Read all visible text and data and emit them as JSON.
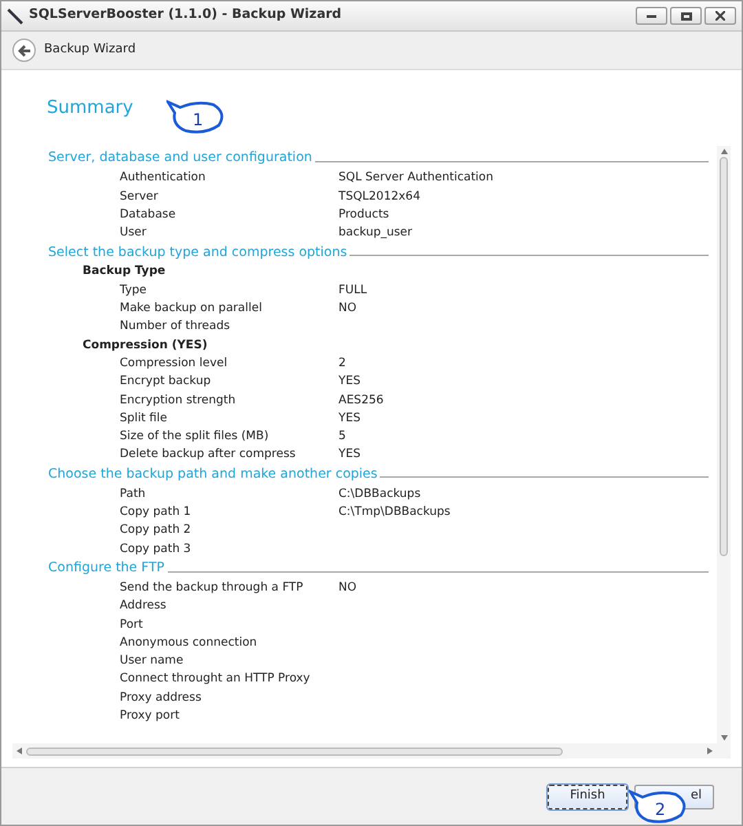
{
  "window": {
    "title": "SQLServerBooster (1.1.0) - Backup Wizard"
  },
  "header": {
    "title": "Backup Wizard"
  },
  "page_title": "Summary",
  "sections": [
    {
      "title": "Server, database and user configuration",
      "items": [
        {
          "kind": "row",
          "label": "Authentication",
          "value": "SQL Server Authentication"
        },
        {
          "kind": "row",
          "label": "Server",
          "value": "TSQL2012x64"
        },
        {
          "kind": "row",
          "label": "Database",
          "value": "Products"
        },
        {
          "kind": "row",
          "label": "User",
          "value": "backup_user"
        }
      ]
    },
    {
      "title": "Select the backup type and compress options",
      "items": [
        {
          "kind": "group",
          "label": "Backup Type"
        },
        {
          "kind": "row",
          "label": "Type",
          "value": "FULL"
        },
        {
          "kind": "row",
          "label": "Make backup on parallel",
          "value": "NO"
        },
        {
          "kind": "row",
          "label": "Number of threads"
        },
        {
          "kind": "group",
          "label": "Compression (YES)"
        },
        {
          "kind": "row",
          "label": "Compression level",
          "value": "2"
        },
        {
          "kind": "row",
          "label": "Encrypt backup",
          "value": "YES"
        },
        {
          "kind": "row",
          "label": "Encryption strength",
          "value": "AES256"
        },
        {
          "kind": "row",
          "label": "Split file",
          "value": "YES"
        },
        {
          "kind": "row",
          "label": "Size of the split files (MB)",
          "value": "5"
        },
        {
          "kind": "row",
          "label": "Delete backup after compress",
          "value": "YES"
        }
      ]
    },
    {
      "title": "Choose the backup path and make another copies",
      "items": [
        {
          "kind": "row",
          "label": "Path",
          "value": "C:\\DBBackups"
        },
        {
          "kind": "row",
          "label": "Copy path 1",
          "value": "C:\\Tmp\\DBBackups"
        },
        {
          "kind": "row",
          "label": "Copy path 2"
        },
        {
          "kind": "row",
          "label": "Copy path 3"
        }
      ]
    },
    {
      "title": "Configure the FTP",
      "items": [
        {
          "kind": "row",
          "label": "Send the backup through a FTP",
          "value": "NO"
        },
        {
          "kind": "row",
          "label": "Address"
        },
        {
          "kind": "row",
          "label": "Port"
        },
        {
          "kind": "row",
          "label": "Anonymous connection"
        },
        {
          "kind": "row",
          "label": "User name"
        },
        {
          "kind": "row",
          "label": "Connect throught an HTTP Proxy"
        },
        {
          "kind": "row",
          "label": "Proxy address"
        },
        {
          "kind": "row",
          "label": "Proxy port"
        }
      ]
    }
  ],
  "buttons": [
    {
      "label": "Finish",
      "focused": true
    },
    {
      "label": "el",
      "focused": false
    }
  ],
  "callouts": [
    "1",
    "2"
  ]
}
